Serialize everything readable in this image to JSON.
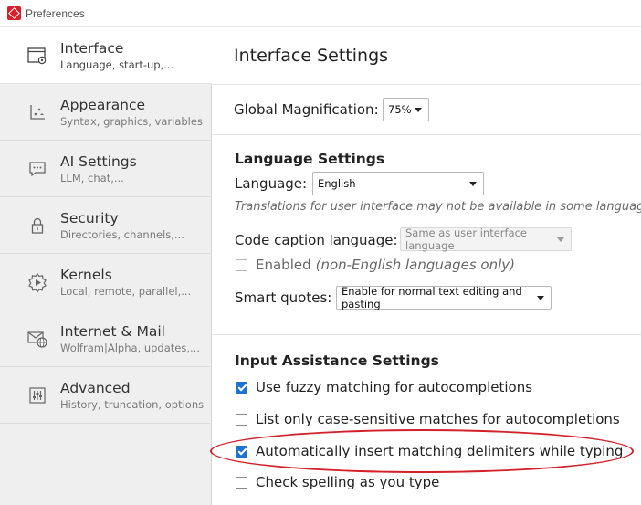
{
  "window": {
    "title": "Preferences"
  },
  "sidebar": {
    "items": [
      {
        "label": "Interface",
        "sub": "Language, start-up,...",
        "icon": "window-gear-icon",
        "active": true
      },
      {
        "label": "Appearance",
        "sub": "Syntax, graphics, variables",
        "icon": "plot-axes-icon"
      },
      {
        "label": "AI Settings",
        "sub": "LLM, chat,...",
        "icon": "chat-bubble-icon"
      },
      {
        "label": "Security",
        "sub": "Directories, channels,...",
        "icon": "lock-icon"
      },
      {
        "label": "Kernels",
        "sub": "Local, remote, parallel,...",
        "icon": "gear-play-icon"
      },
      {
        "label": "Internet & Mail",
        "sub": "Wolfram|Alpha, updates,...",
        "icon": "mail-globe-icon"
      },
      {
        "label": "Advanced",
        "sub": "History, truncation, options",
        "icon": "sliders-icon"
      }
    ]
  },
  "main": {
    "title": "Interface Settings",
    "magnification": {
      "label": "Global Magnification:",
      "value": "75%"
    },
    "language_settings": {
      "heading": "Language Settings",
      "language_label": "Language:",
      "language_value": "English",
      "translation_note": "Translations for user interface may not be available in some languages.",
      "code_caption_label": "Code caption language:",
      "code_caption_value": "Same as user interface language",
      "enabled_label": "Enabled",
      "enabled_note": "(non-English languages only)",
      "enabled_checked": false,
      "smart_quotes_label": "Smart quotes:",
      "smart_quotes_value": "Enable for normal text editing and pasting"
    },
    "input_assistance": {
      "heading": "Input Assistance Settings",
      "options": [
        {
          "label": "Use fuzzy matching for autocompletions",
          "checked": true
        },
        {
          "label": "List only case-sensitive matches for autocompletions",
          "checked": false
        },
        {
          "label": "Automatically insert matching delimiters while typing",
          "checked": true
        },
        {
          "label": "Check spelling as you type",
          "checked": false
        }
      ]
    }
  },
  "colors": {
    "accent": "#1e73d2",
    "highlight": "#d3202a",
    "sidebar_bg": "#efefef"
  }
}
